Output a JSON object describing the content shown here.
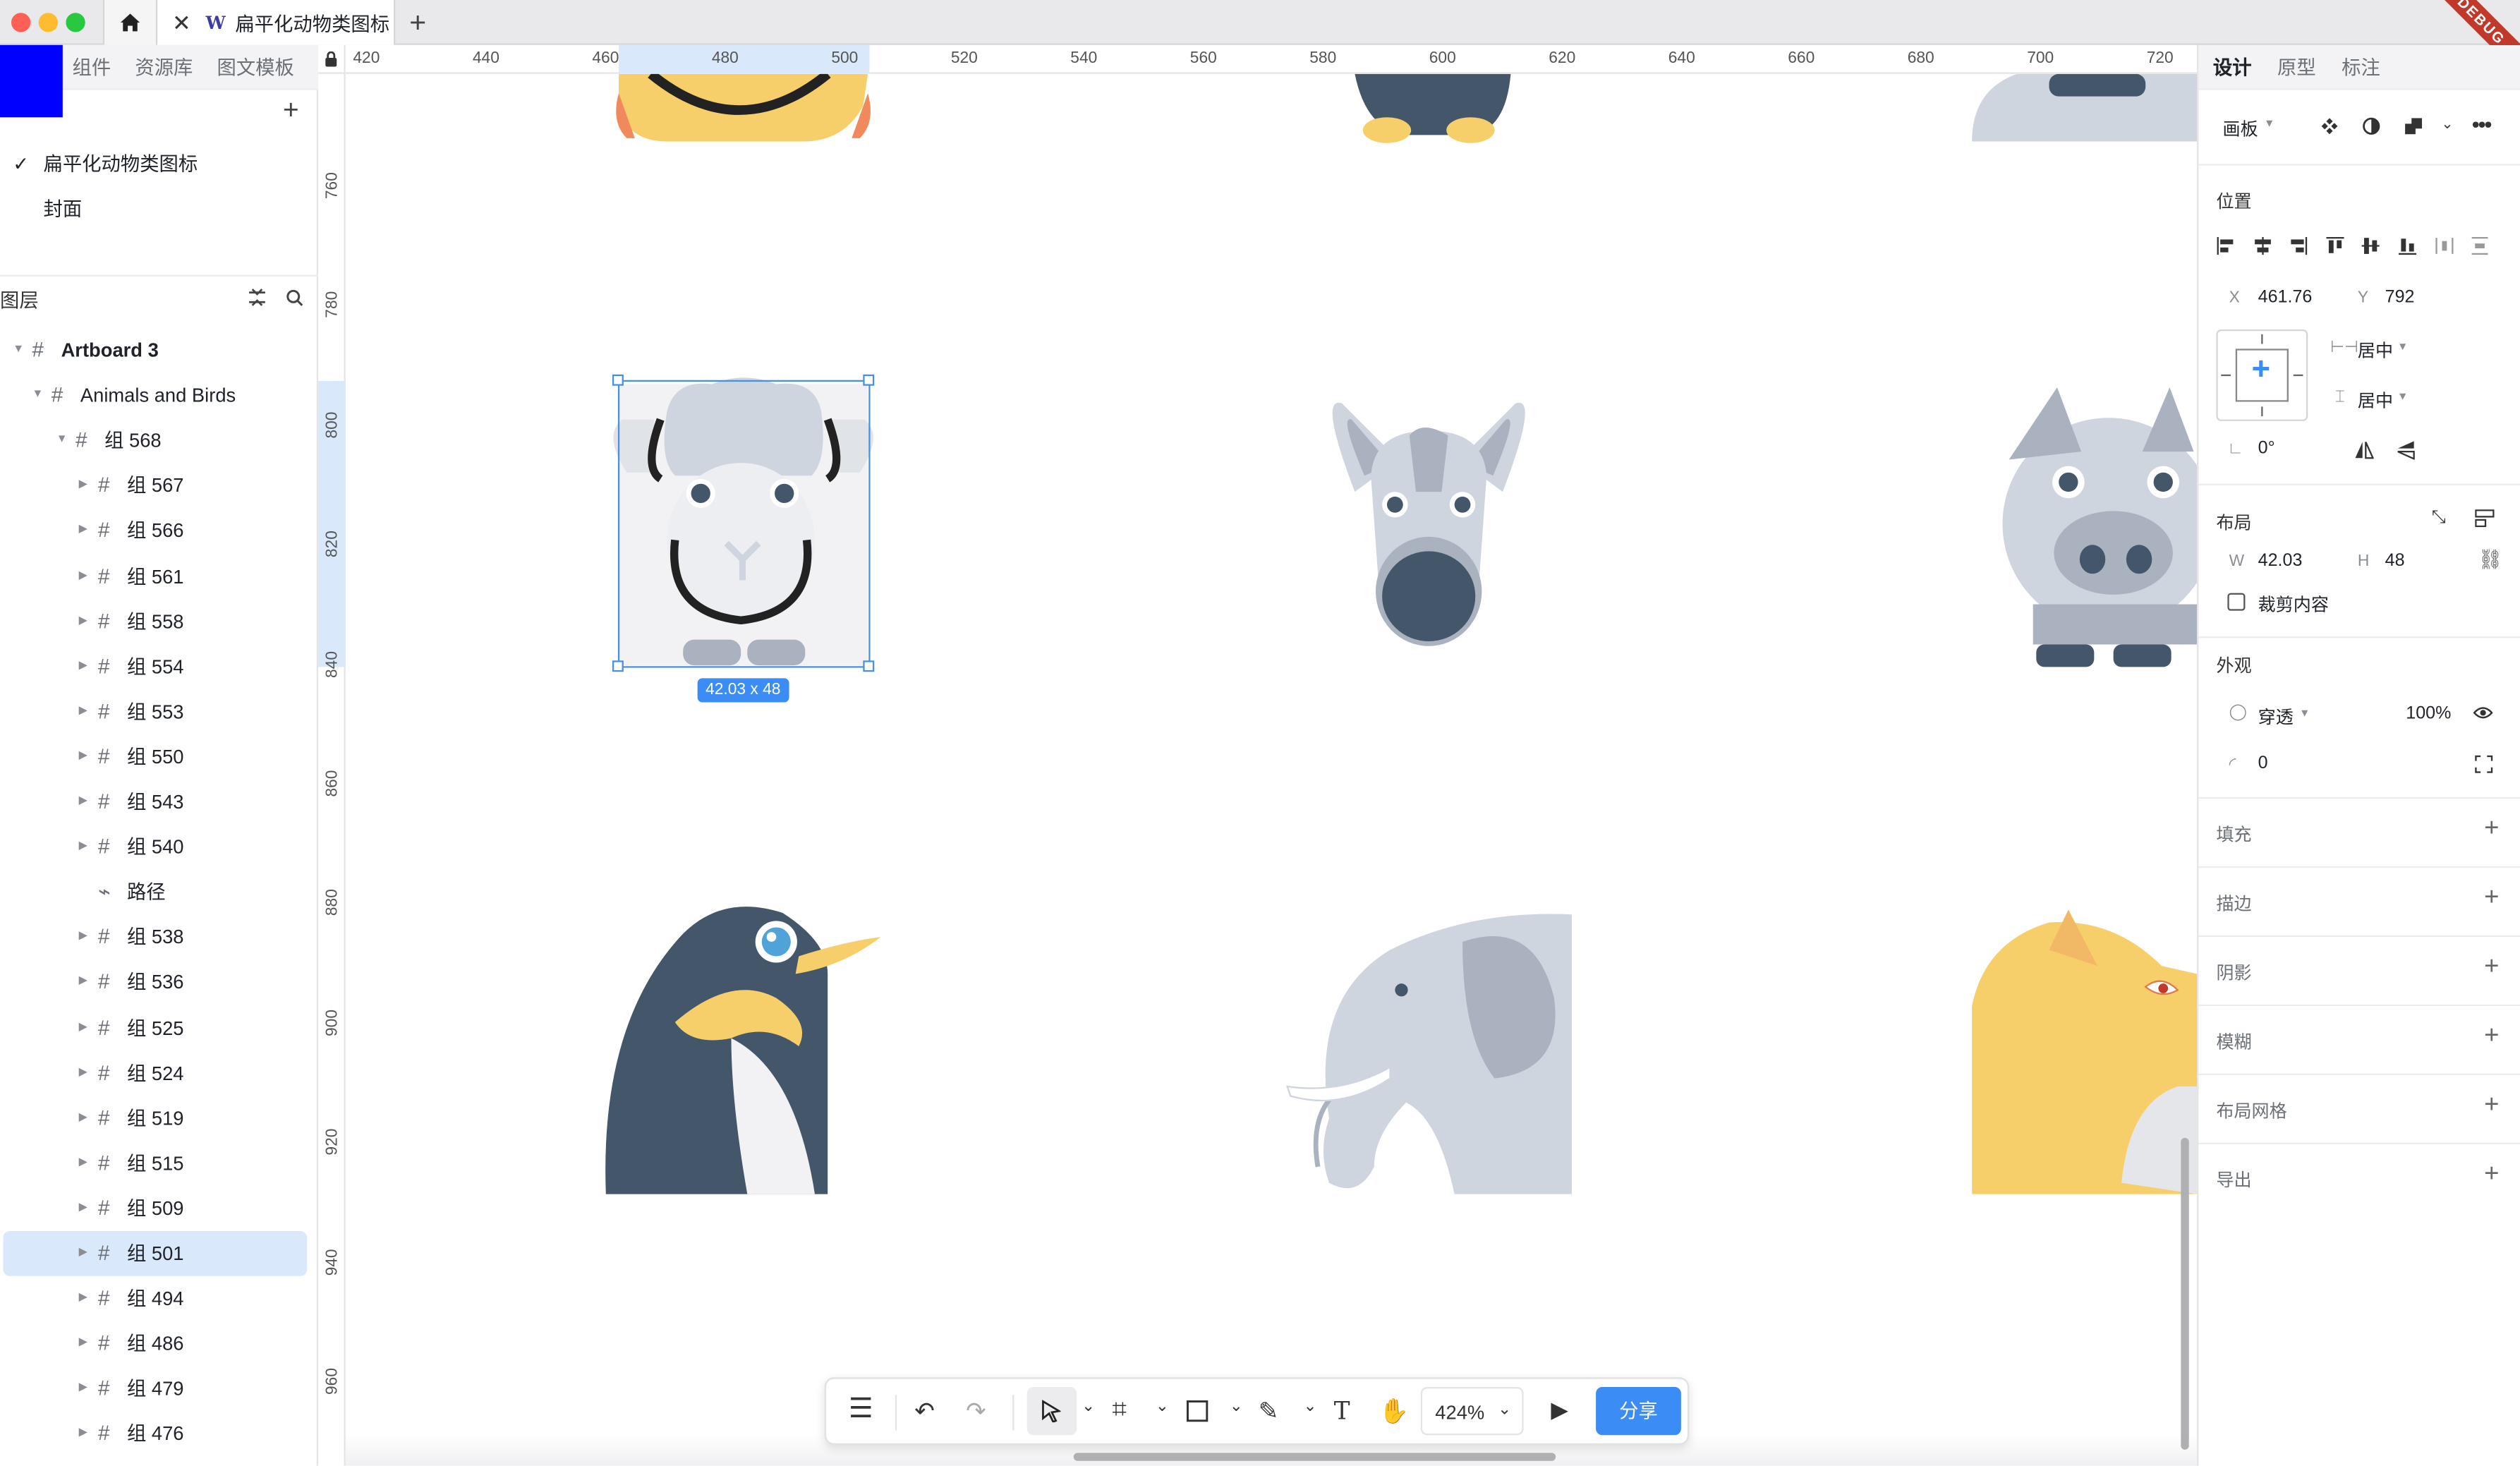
{
  "titlebar": {
    "doc_title": "扁平化动物类图标",
    "doc_icon": "W",
    "close_glyph": "✕",
    "add_glyph": "+",
    "debug_badge": "DEBUG"
  },
  "left_panel": {
    "tabs": [
      "组件",
      "资源库",
      "图文模板"
    ],
    "pages": [
      {
        "label": "扁平化动物类图标",
        "checked": true
      },
      {
        "label": "封面",
        "checked": false
      }
    ],
    "layers_title": "图层",
    "layers": [
      {
        "label": "Artboard 3",
        "depth": 0,
        "expanded": true,
        "type": "frame",
        "bold": true
      },
      {
        "label": "Animals and Birds",
        "depth": 1,
        "expanded": true,
        "type": "frame"
      },
      {
        "label": "组 568",
        "depth": 2,
        "expanded": true,
        "type": "frame"
      },
      {
        "label": "组 567",
        "depth": 3,
        "expanded": false,
        "type": "frame"
      },
      {
        "label": "组 566",
        "depth": 3,
        "expanded": false,
        "type": "frame"
      },
      {
        "label": "组 561",
        "depth": 3,
        "expanded": false,
        "type": "frame"
      },
      {
        "label": "组 558",
        "depth": 3,
        "expanded": false,
        "type": "frame"
      },
      {
        "label": "组 554",
        "depth": 3,
        "expanded": false,
        "type": "frame"
      },
      {
        "label": "组 553",
        "depth": 3,
        "expanded": false,
        "type": "frame"
      },
      {
        "label": "组 550",
        "depth": 3,
        "expanded": false,
        "type": "frame"
      },
      {
        "label": "组 543",
        "depth": 3,
        "expanded": false,
        "type": "frame"
      },
      {
        "label": "组 540",
        "depth": 3,
        "expanded": false,
        "type": "frame"
      },
      {
        "label": "路径",
        "depth": 3,
        "expanded": false,
        "type": "path"
      },
      {
        "label": "组 538",
        "depth": 3,
        "expanded": false,
        "type": "frame"
      },
      {
        "label": "组 536",
        "depth": 3,
        "expanded": false,
        "type": "frame"
      },
      {
        "label": "组 525",
        "depth": 3,
        "expanded": false,
        "type": "frame"
      },
      {
        "label": "组 524",
        "depth": 3,
        "expanded": false,
        "type": "frame"
      },
      {
        "label": "组 519",
        "depth": 3,
        "expanded": false,
        "type": "frame"
      },
      {
        "label": "组 515",
        "depth": 3,
        "expanded": false,
        "type": "frame"
      },
      {
        "label": "组 509",
        "depth": 3,
        "expanded": false,
        "type": "frame"
      },
      {
        "label": "组 501",
        "depth": 3,
        "expanded": false,
        "type": "frame",
        "selected": true
      },
      {
        "label": "组 494",
        "depth": 3,
        "expanded": false,
        "type": "frame"
      },
      {
        "label": "组 486",
        "depth": 3,
        "expanded": false,
        "type": "frame"
      },
      {
        "label": "组 479",
        "depth": 3,
        "expanded": false,
        "type": "frame"
      },
      {
        "label": "组 476",
        "depth": 3,
        "expanded": false,
        "type": "frame"
      }
    ]
  },
  "rulers": {
    "horizontal": [
      "420",
      "440",
      "460",
      "480",
      "500",
      "520",
      "540",
      "560",
      "580",
      "600",
      "620",
      "640",
      "660",
      "680",
      "700",
      "720"
    ],
    "vertical": [
      "760",
      "780",
      "800",
      "820",
      "840",
      "860",
      "880",
      "900",
      "920",
      "940",
      "960"
    ]
  },
  "canvas": {
    "selection_size": "42.03 x 48"
  },
  "right_panel": {
    "tabs": [
      "设计",
      "原型",
      "标注"
    ],
    "frame_selector": "画板",
    "position_title": "位置",
    "x_label": "X",
    "x_value": "461.76",
    "y_label": "Y",
    "y_value": "792",
    "h_constraint": "居中",
    "v_constraint": "居中",
    "rotation": "0°",
    "layout_title": "布局",
    "w_label": "W",
    "w_value": "42.03",
    "h_label": "H",
    "h_value": "48",
    "clip_content": "裁剪内容",
    "appearance_title": "外观",
    "blend_mode": "穿透",
    "opacity": "100%",
    "radius": "0",
    "sections": [
      "填充",
      "描边",
      "阴影",
      "模糊",
      "布局网格",
      "导出"
    ]
  },
  "toolbar": {
    "zoom": "424%",
    "share": "分享"
  },
  "colors": {
    "accent": "#3b8cf5",
    "selection": "#4a90e2",
    "selected_row": "#d9e8fb"
  }
}
